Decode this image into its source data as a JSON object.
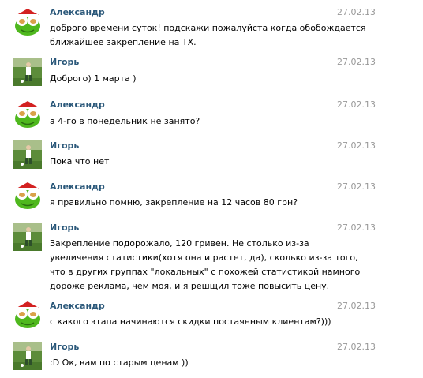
{
  "messages": [
    {
      "author": "Александр",
      "date": "27.02.13",
      "avatar": "frog-avatar-icon",
      "lines": [
        "доброго времени суток! подскажи пожалуйста когда обобождается",
        "ближайшее закрепление на ТХ."
      ]
    },
    {
      "author": "Игорь",
      "date": "27.02.13",
      "avatar": "football-player-avatar-icon",
      "lines": [
        "Доброго) 1 марта )"
      ]
    },
    {
      "author": "Александр",
      "date": "27.02.13",
      "avatar": "frog-avatar-icon",
      "lines": [
        "а 4-го в понедельник не занято?"
      ]
    },
    {
      "author": "Игорь",
      "date": "27.02.13",
      "avatar": "football-player-avatar-icon",
      "lines": [
        "Пока что нет"
      ]
    },
    {
      "author": "Александр",
      "date": "27.02.13",
      "avatar": "frog-avatar-icon",
      "lines": [
        "я правильно помню, закрепление на 12 часов 80 грн?"
      ]
    },
    {
      "author": "Игорь",
      "date": "27.02.13",
      "avatar": "football-player-avatar-icon",
      "lines": [
        "Закрепление подорожало, 120 гривен. Не столько из-за",
        "увеличения статистики(хотя она и растет, да), сколько из-за того,",
        "что в других группах \"локальных\" с похожей статистикой намного",
        "дороже реклама, чем моя, и я решщил тоже повысить цену."
      ]
    },
    {
      "author": "Александр",
      "date": "27.02.13",
      "avatar": "frog-avatar-icon",
      "lines": [
        "с какого этапа начинаются скидки постаянным клиентам?)))"
      ]
    },
    {
      "author": "Игорь",
      "date": "27.02.13",
      "avatar": "football-player-avatar-icon",
      "lines": [
        ":D Ок, вам по старым ценам ))"
      ]
    }
  ]
}
